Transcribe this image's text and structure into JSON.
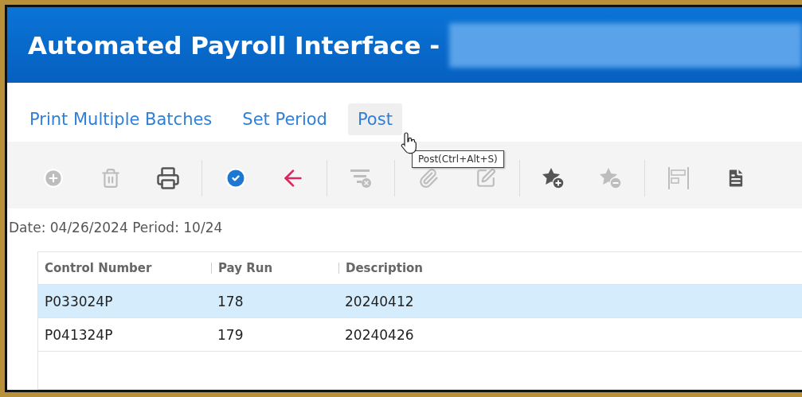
{
  "window": {
    "title": "Automated Payroll Interface -"
  },
  "menu": [
    {
      "label": "Print Multiple Batches",
      "hovered": false
    },
    {
      "label": "Set Period",
      "hovered": false
    },
    {
      "label": "Post",
      "hovered": true
    }
  ],
  "tooltip": "Post(Ctrl+Alt+S)",
  "toolbar": [
    {
      "kind": "add",
      "disabled": true
    },
    {
      "kind": "delete",
      "disabled": true
    },
    {
      "kind": "print",
      "disabled": false
    },
    {
      "kind": "separator"
    },
    {
      "kind": "post",
      "disabled": false
    },
    {
      "kind": "back",
      "disabled": false
    },
    {
      "kind": "separator"
    },
    {
      "kind": "clear-filter",
      "disabled": true
    },
    {
      "kind": "separator"
    },
    {
      "kind": "attach",
      "disabled": true
    },
    {
      "kind": "edit",
      "disabled": true
    },
    {
      "kind": "separator"
    },
    {
      "kind": "add-favorite",
      "disabled": false
    },
    {
      "kind": "remove-favorite",
      "disabled": true
    },
    {
      "kind": "separator"
    },
    {
      "kind": "layout",
      "disabled": true
    },
    {
      "kind": "document",
      "disabled": false
    }
  ],
  "info": "Date: 04/26/2024 Period: 10/24",
  "table": {
    "columns": [
      "Control Number",
      "Pay Run",
      "Description"
    ],
    "rows": [
      {
        "cells": [
          "P033024P",
          "178",
          "20240412"
        ],
        "selected": true
      },
      {
        "cells": [
          "P041324P",
          "179",
          "20240426"
        ],
        "selected": false
      }
    ]
  }
}
